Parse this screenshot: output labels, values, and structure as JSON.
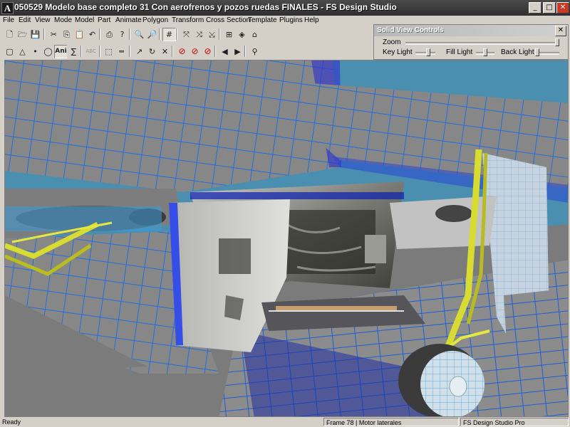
{
  "window": {
    "title": "050529 Modelo base completo 31 Con aerofrenos y pozos ruedas FINALES - FS Design Studio",
    "app_icon": "A",
    "minimize_label": "_",
    "maximize_label": "□",
    "close_label": "✕"
  },
  "menu": [
    "File",
    "Edit",
    "View",
    "Mode",
    "Model",
    "Part",
    "Animate",
    "Polygon",
    "Transform",
    "Cross Section",
    "Template",
    "Plugins",
    "Help"
  ],
  "toolbar1": [
    {
      "icon": "new-file-icon",
      "glyph": "🗋"
    },
    {
      "icon": "open-folder-icon",
      "glyph": "🗁"
    },
    {
      "icon": "save-icon",
      "glyph": "💾"
    },
    {
      "icon": "cut-icon",
      "glyph": "✂"
    },
    {
      "icon": "copy-icon",
      "glyph": "⎘"
    },
    {
      "icon": "paste-icon",
      "glyph": "📋"
    },
    {
      "icon": "undo-icon",
      "glyph": "↶"
    },
    {
      "icon": "print-icon",
      "glyph": "⎙"
    },
    {
      "icon": "help-icon",
      "glyph": "?"
    },
    {
      "icon": "zoom-in-icon",
      "glyph": "🔍"
    },
    {
      "icon": "zoom-out-icon",
      "glyph": "🔎"
    },
    {
      "icon": "grid-icon",
      "glyph": "#"
    },
    {
      "icon": "move-x-icon",
      "glyph": "⤧"
    },
    {
      "icon": "move-y-icon",
      "glyph": "⤨"
    },
    {
      "icon": "move-z-icon",
      "glyph": "⤩"
    },
    {
      "icon": "lock-view-icon",
      "glyph": "⊞"
    },
    {
      "icon": "render-icon",
      "glyph": "◈"
    },
    {
      "icon": "home-icon",
      "glyph": "⌂"
    }
  ],
  "toolbar2": [
    {
      "icon": "select-box-icon",
      "glyph": "▢"
    },
    {
      "icon": "triangle-icon",
      "glyph": "△"
    },
    {
      "icon": "point-icon",
      "glyph": "•"
    },
    {
      "icon": "circle-icon",
      "glyph": "◯"
    },
    {
      "icon": "animation-icon",
      "glyph": "Ani"
    },
    {
      "icon": "sum-icon",
      "glyph": "∑"
    },
    {
      "icon": "abc-icon",
      "glyph": "ABC"
    },
    {
      "icon": "marquee-icon",
      "glyph": "⬚"
    },
    {
      "icon": "ruler-icon",
      "glyph": "═"
    },
    {
      "icon": "rotate-icon",
      "glyph": "↗"
    },
    {
      "icon": "redo-icon",
      "glyph": "↻"
    },
    {
      "icon": "shrink-icon",
      "glyph": "✕"
    },
    {
      "icon": "no-symbol-1-icon",
      "glyph": "⊘"
    },
    {
      "icon": "no-symbol-2-icon",
      "glyph": "⊘"
    },
    {
      "icon": "no-symbol-3-icon",
      "glyph": "⊘"
    },
    {
      "icon": "arrow-left-icon",
      "glyph": "◀"
    },
    {
      "icon": "arrow-right-icon",
      "glyph": "▶"
    },
    {
      "icon": "binoculars-icon",
      "glyph": "⚲"
    }
  ],
  "solid_view_controls": {
    "title": "Solid View Controls",
    "close_label": "✕",
    "zoom_label": "Zoom",
    "key_light_label": "Key Light",
    "fill_light_label": "Fill Light",
    "back_light_label": "Back Light"
  },
  "status": {
    "left": "Ready",
    "middle": "Frame 78 | Motor laterales",
    "right": "FS Design Studio Pro"
  },
  "colors": {
    "viewport_sky": "#4b8fb0",
    "gray_surface": "#8a8a8a",
    "wire_blue": "#1e6fe0",
    "gear_yellow": "#d8dc30",
    "wheel_white": "#c8dbe8"
  }
}
